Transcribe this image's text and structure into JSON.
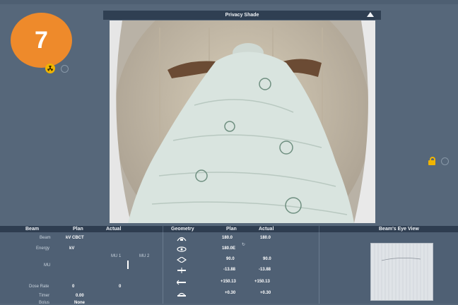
{
  "badge": {
    "number": "7"
  },
  "privacy_shade": {
    "title": "Privacy Shade"
  },
  "beam_panel": {
    "headers": {
      "beam": "Beam",
      "plan": "Plan",
      "actual": "Actual"
    },
    "rows": {
      "beam": {
        "label": "Beam",
        "plan": "kV CBCT"
      },
      "energy": {
        "label": "Energy",
        "plan": "kV"
      },
      "mu": {
        "label": "MU",
        "mu1": "MU 1",
        "mu2": "MU 2"
      },
      "dose_rate": {
        "label": "Dose Rate",
        "plan": "0",
        "actual": "0"
      },
      "timer": {
        "label": "Timer",
        "plan": "0.00"
      },
      "bolus": {
        "label": "Bolus",
        "plan": "None"
      }
    }
  },
  "geometry_panel": {
    "headers": {
      "geometry": "Geometry",
      "plan": "Plan",
      "actual": "Actual"
    },
    "rows": [
      {
        "icon": "gantry-icon",
        "plan": "180.0",
        "actual": "180.0"
      },
      {
        "icon": "collimator-icon",
        "plan": "180.0E",
        "actual": ""
      },
      {
        "icon": "couch-rotation-icon",
        "plan": "90.0",
        "actual": "90.0"
      },
      {
        "icon": "couch-vertical-icon",
        "plan": "-13.88",
        "actual": "-13.88"
      },
      {
        "icon": "couch-longitudinal-icon",
        "plan": "+150.13",
        "actual": "+150.13"
      },
      {
        "icon": "couch-lateral-icon",
        "plan": "+0.30",
        "actual": "+0.30"
      }
    ]
  },
  "bev_panel": {
    "header": "Beam's Eye View"
  },
  "colors": {
    "accent": "#ee8a2b",
    "warning": "#f0b400",
    "panel_bg": "#4f6074",
    "header_bg": "#2e3d50"
  }
}
